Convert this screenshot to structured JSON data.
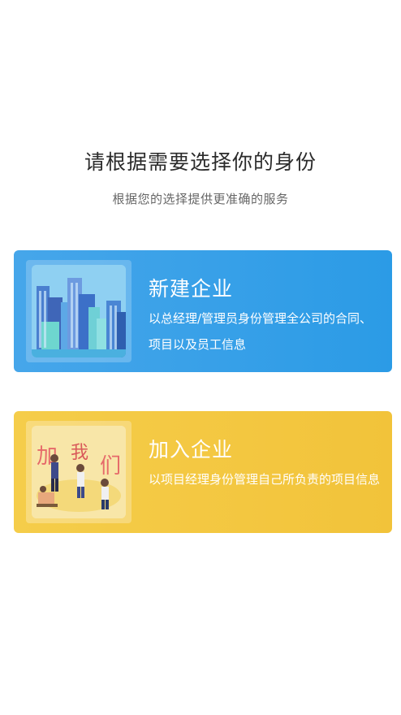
{
  "heading": {
    "title": "请根据需要选择你的身份",
    "subtitle": "根据您的选择提供更准确的服务"
  },
  "cards": [
    {
      "title": "新建企业",
      "description": "以总经理/管理员身份管理全公司的合同、项目以及员工信息",
      "color": "#2b9be6",
      "illustration": "city-buildings-illustration"
    },
    {
      "title": "加入企业",
      "description": "以项目经理身份管理自己所负责的项目信息",
      "color": "#f2c33a",
      "illustration": "team-join-illustration"
    }
  ]
}
